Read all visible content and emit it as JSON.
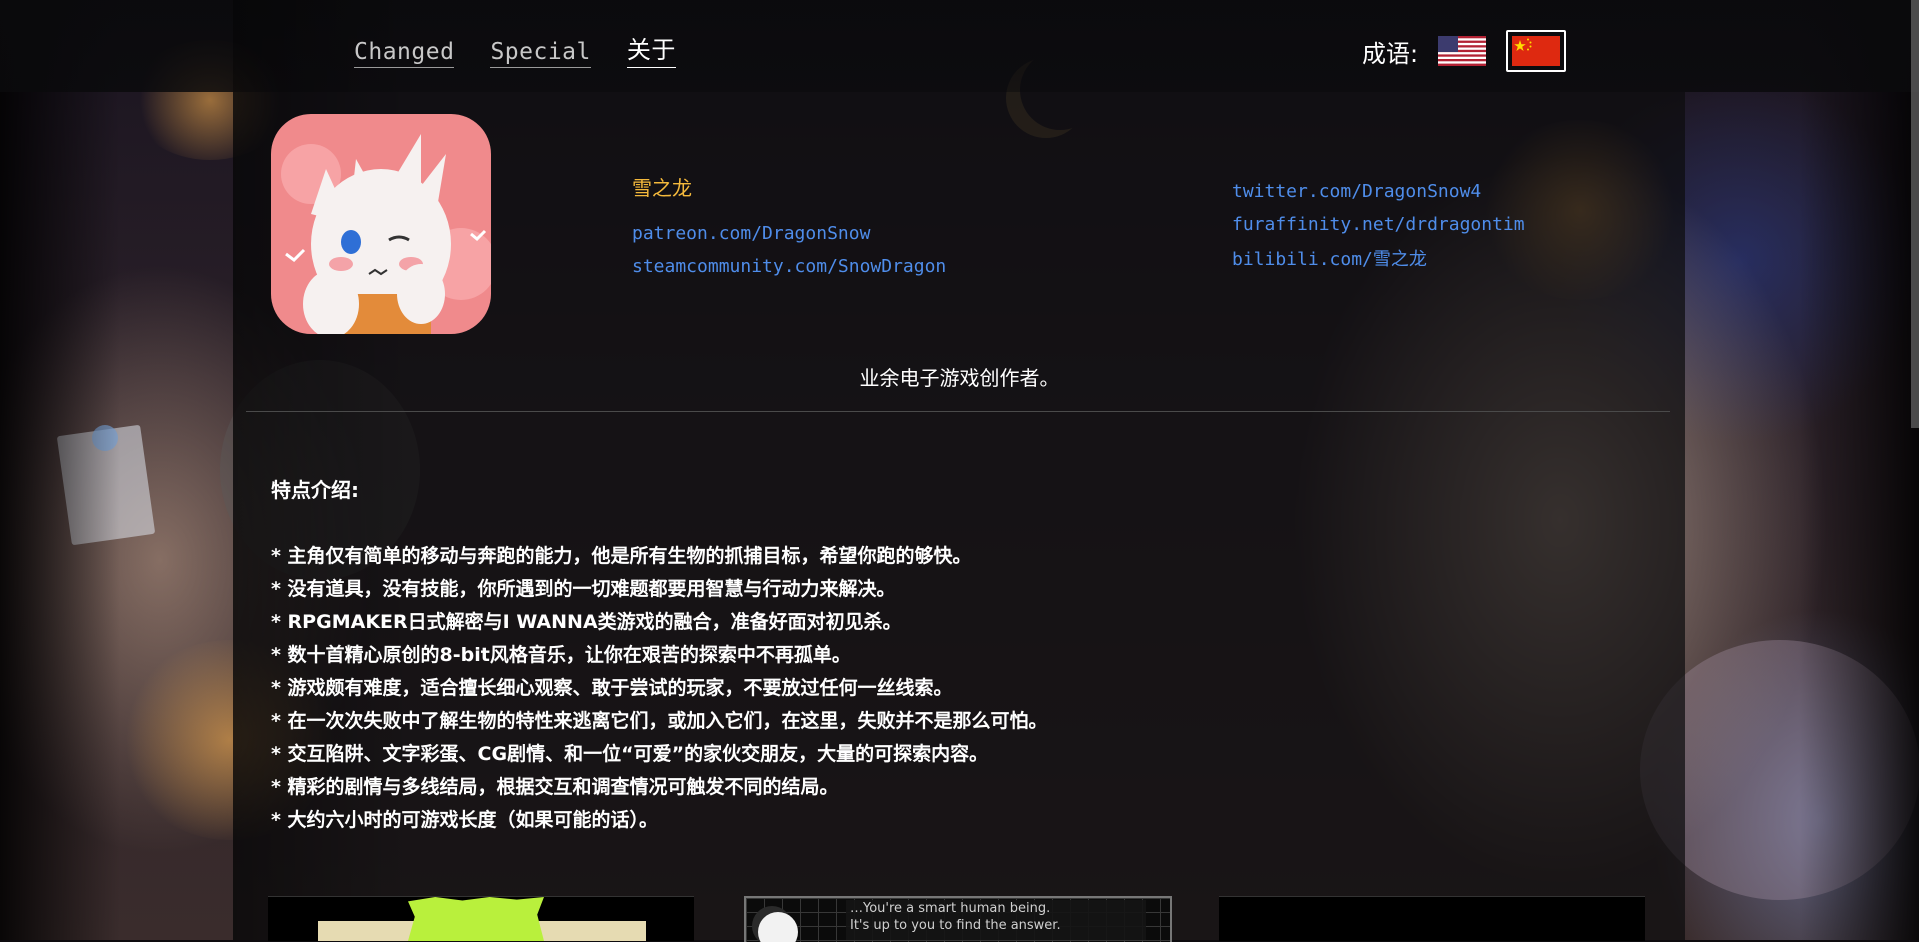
{
  "nav": {
    "items": [
      {
        "label": "Changed",
        "active": false
      },
      {
        "label": "Special",
        "active": false
      },
      {
        "label": "关于",
        "active": true
      }
    ]
  },
  "language": {
    "label": "成语:",
    "options": [
      {
        "name": "english-flag",
        "selected": false
      },
      {
        "name": "chinese-flag",
        "selected": true
      }
    ]
  },
  "profile": {
    "name": "雪之龙",
    "links_left": [
      "patreon.com/DragonSnow",
      "steamcommunity.com/SnowDragon"
    ],
    "links_right": [
      "twitter.com/DragonSnow4",
      "furaffinity.net/drdragontim",
      "bilibili.com/雪之龙"
    ],
    "tagline": "业余电子游戏创作者。"
  },
  "features": {
    "title": "特点介绍:",
    "items": [
      "* 主角仅有简单的移动与奔跑的能力，他是所有生物的抓捕目标，希望你跑的够快。",
      "* 没有道具，没有技能，你所遇到的一切难题都要用智慧与行动力来解决。",
      "* RPGMAKER日式解密与I WANNA类游戏的融合，准备好面对初见杀。",
      "* 数十首精心原创的8-bit风格音乐，让你在艰苦的探索中不再孤单。",
      "* 游戏颇有难度，适合擅长细心观察、敢于尝试的玩家，不要放过任何一丝线索。",
      "* 在一次次失败中了解生物的特性来逃离它们，或加入它们，在这里，失败并不是那么可怕。",
      "* 交互陷阱、文字彩蛋、CG剧情、和一位“可爱”的家伙交朋友，大量的可探索内容。",
      "* 精彩的剧情与多线结局，根据交互和调查情况可触发不同的结局。",
      "* 大约六小时的可游戏长度（如果可能的话）。"
    ]
  },
  "screenshots": {
    "dialog_lines": [
      "…You're a smart human being.",
      "It's up to you to find the answer."
    ]
  },
  "colors": {
    "accent_name": "#f4b93c",
    "link": "#4f8dea",
    "text": "#ffffff"
  }
}
